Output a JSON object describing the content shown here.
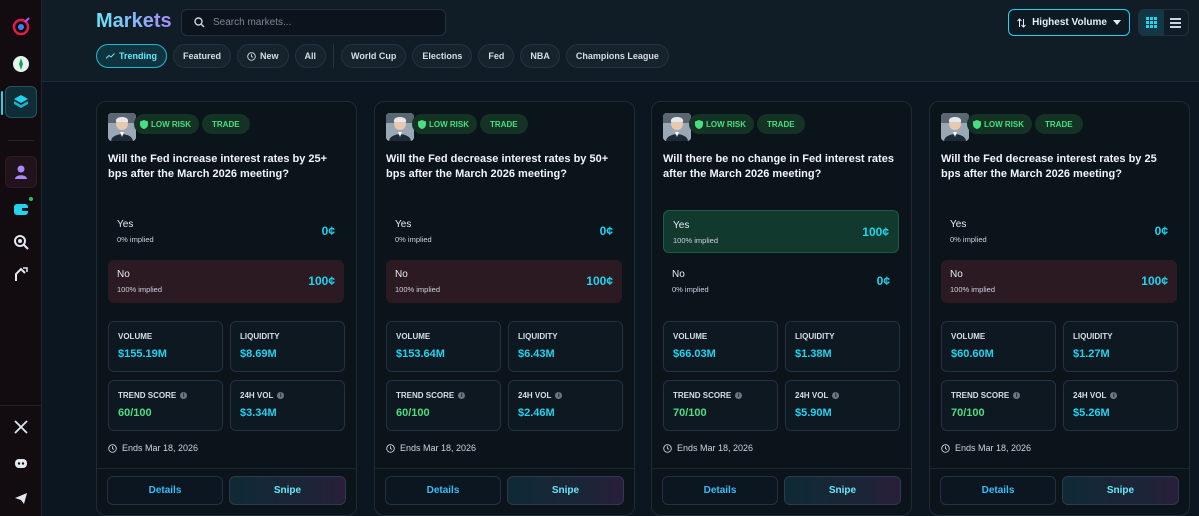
{
  "header": {
    "title": "Markets",
    "search_placeholder": "Search markets...",
    "sort_label": "Highest Volume"
  },
  "chips": [
    {
      "label": "Trending",
      "icon": "trending-icon",
      "active": true
    },
    {
      "label": "Featured"
    },
    {
      "label": "New",
      "icon": "clock-icon"
    },
    {
      "label": "All"
    },
    {
      "label": "World Cup"
    },
    {
      "label": "Elections"
    },
    {
      "label": "Fed"
    },
    {
      "label": "NBA"
    },
    {
      "label": "Champions League"
    }
  ],
  "colors": {
    "accent": "#22d3ee",
    "positive": "#4ade80",
    "background": "#0c1620"
  },
  "cards": [
    {
      "risk": "LOW RISK",
      "tag": "TRADE",
      "question": "Will the Fed increase interest rates by 25+ bps after the March 2026 meeting?",
      "yes": {
        "label": "Yes",
        "implied": "0% implied",
        "price": "0¢"
      },
      "no": {
        "label": "No",
        "implied": "100% implied",
        "price": "100¢"
      },
      "stats": {
        "volume_label": "VOLUME",
        "volume": "$155.19M",
        "liquidity_label": "LIQUIDITY",
        "liquidity": "$8.69M",
        "trend_label": "TREND SCORE",
        "trend": "60/100",
        "vol24_label": "24H VOL",
        "vol24": "$3.34M"
      },
      "ends": "Ends Mar 18, 2026",
      "details": "Details",
      "snipe": "Snipe"
    },
    {
      "risk": "LOW RISK",
      "tag": "TRADE",
      "question": "Will the Fed decrease interest rates by 50+ bps after the March 2026 meeting?",
      "yes": {
        "label": "Yes",
        "implied": "0% implied",
        "price": "0¢"
      },
      "no": {
        "label": "No",
        "implied": "100% implied",
        "price": "100¢"
      },
      "stats": {
        "volume_label": "VOLUME",
        "volume": "$153.64M",
        "liquidity_label": "LIQUIDITY",
        "liquidity": "$6.43M",
        "trend_label": "TREND SCORE",
        "trend": "60/100",
        "vol24_label": "24H VOL",
        "vol24": "$2.46M"
      },
      "ends": "Ends Mar 18, 2026",
      "details": "Details",
      "snipe": "Snipe"
    },
    {
      "risk": "LOW RISK",
      "tag": "TRADE",
      "question": "Will there be no change in Fed interest rates after the March 2026 meeting?",
      "yes": {
        "label": "Yes",
        "implied": "100% implied",
        "price": "100¢"
      },
      "no": {
        "label": "No",
        "implied": "0% implied",
        "price": "0¢"
      },
      "stats": {
        "volume_label": "VOLUME",
        "volume": "$66.03M",
        "liquidity_label": "LIQUIDITY",
        "liquidity": "$1.38M",
        "trend_label": "TREND SCORE",
        "trend": "70/100",
        "vol24_label": "24H VOL",
        "vol24": "$5.90M"
      },
      "ends": "Ends Mar 18, 2026",
      "details": "Details",
      "snipe": "Snipe"
    },
    {
      "risk": "LOW RISK",
      "tag": "TRADE",
      "question": "Will the Fed decrease interest rates by 25 bps after the March 2026 meeting?",
      "yes": {
        "label": "Yes",
        "implied": "0% implied",
        "price": "0¢"
      },
      "no": {
        "label": "No",
        "implied": "100% implied",
        "price": "100¢"
      },
      "stats": {
        "volume_label": "VOLUME",
        "volume": "$60.60M",
        "liquidity_label": "LIQUIDITY",
        "liquidity": "$1.27M",
        "trend_label": "TREND SCORE",
        "trend": "70/100",
        "vol24_label": "24H VOL",
        "vol24": "$5.26M"
      },
      "ends": "Ends Mar 18, 2026",
      "details": "Details",
      "snipe": "Snipe"
    }
  ]
}
